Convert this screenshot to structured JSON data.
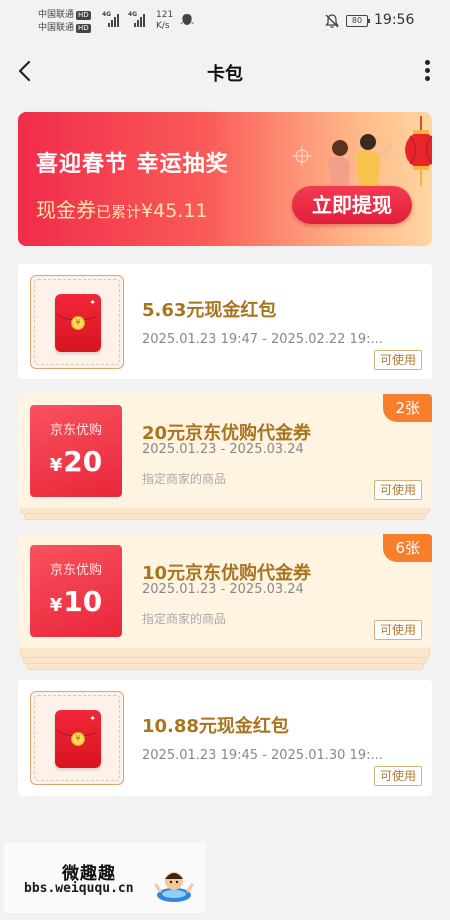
{
  "status_bar": {
    "carrier1": "中国联通",
    "carrier2": "中国联通",
    "hd_badge": "HD",
    "signal_label": "4G",
    "net_speed_value": "121",
    "net_speed_unit": "K/s",
    "battery": "80",
    "time": "19:56"
  },
  "nav": {
    "title": "卡包"
  },
  "banner": {
    "title": "喜迎春节 幸运抽奖",
    "sub_label": "现金券",
    "sub_small": "已累计",
    "amount": "¥45.11",
    "button_label": "立即提现"
  },
  "cards": [
    {
      "title": "5.63元现金红包",
      "date": "2025.01.23 19:47 - 2025.02.22 19:...",
      "tag": "可使用"
    },
    {
      "title": "20元京东优购代金券",
      "date": "2025.01.23 - 2025.03.24",
      "note": "指定商家的商品",
      "tag": "可使用",
      "badge": "2张",
      "thumb_brand": "京东优购",
      "thumb_symbol": "¥",
      "thumb_value": "20"
    },
    {
      "title": "10元京东优购代金券",
      "date": "2025.01.23 - 2025.03.24",
      "note": "指定商家的商品",
      "tag": "可使用",
      "badge": "6张",
      "thumb_brand": "京东优购",
      "thumb_symbol": "¥",
      "thumb_value": "10"
    },
    {
      "title": "10.88元现金红包",
      "date": "2025.01.23 19:45 - 2025.01.30 19:...",
      "tag": "可使用"
    }
  ],
  "redpack_coin": "¥",
  "watermark": {
    "title": "微趣趣",
    "url": "bbs.weiququ.cn"
  },
  "colors": {
    "accent": "#f02c4b",
    "title_gold": "#a8741f",
    "badge_orange": "#f77e2a"
  }
}
